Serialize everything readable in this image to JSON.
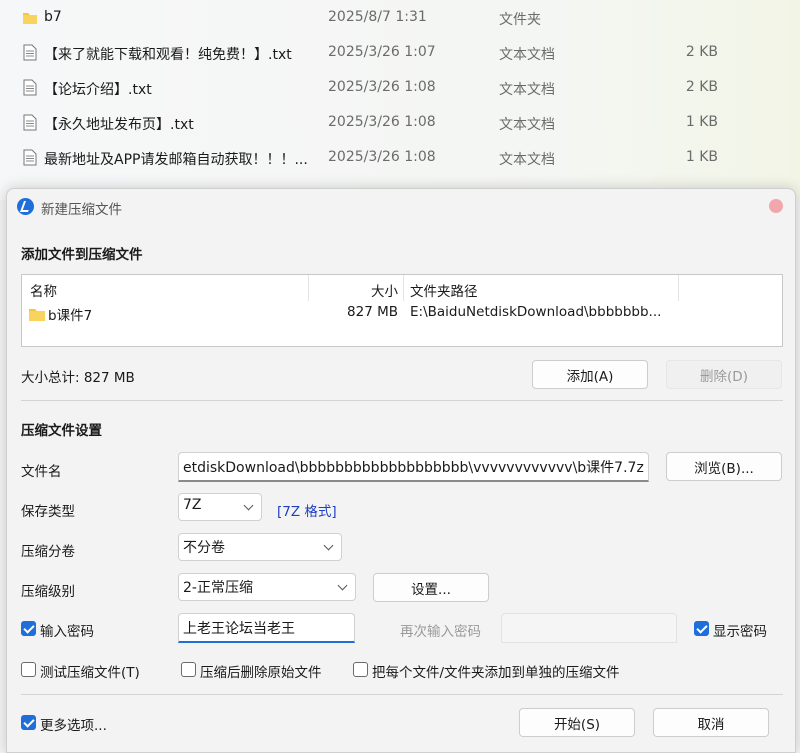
{
  "explorer": {
    "rows": [
      {
        "name": "b7",
        "date": "2025/8/7 1:31",
        "type": "文件夹",
        "size": "",
        "icon": "folder-icon"
      },
      {
        "name": "【来了就能下载和观看！纯免费！】.txt",
        "date": "2025/3/26 1:07",
        "type": "文本文档",
        "size": "2 KB",
        "icon": "text-file-icon"
      },
      {
        "name": "【论坛介绍】.txt",
        "date": "2025/3/26 1:08",
        "type": "文本文档",
        "size": "2 KB",
        "icon": "text-file-icon"
      },
      {
        "name": "【永久地址发布页】.txt",
        "date": "2025/3/26 1:08",
        "type": "文本文档",
        "size": "1 KB",
        "icon": "text-file-icon"
      },
      {
        "name": "最新地址及APP请发邮箱自动获取！！！...",
        "date": "2025/3/26 1:08",
        "type": "文本文档",
        "size": "1 KB",
        "icon": "text-file-icon"
      }
    ]
  },
  "dialog": {
    "title": "新建压缩文件",
    "add_section_title": "添加文件到压缩文件",
    "list": {
      "headers": {
        "name": "名称",
        "size": "大小",
        "path": "文件夹路径"
      },
      "rows": [
        {
          "name": "b课件7",
          "size": "827 MB",
          "path": "E:\\BaiduNetdiskDownload\\bbbbbbb..."
        }
      ]
    },
    "total_size": "大小总计: 827 MB",
    "add_button": "添加(A)",
    "delete_button": "删除(D)",
    "settings_section_title": "压缩文件设置",
    "filename_label": "文件名",
    "filename_value": "etdiskDownload\\bbbbbbbbbbbbbbbbbbb\\vvvvvvvvvvvv\\b课件7.7z",
    "browse_button": "浏览(B)...",
    "save_type_label": "保存类型",
    "save_type_value": "7Z",
    "format_link": "[7Z 格式]",
    "split_label": "压缩分卷",
    "split_value": "不分卷",
    "level_label": "压缩级别",
    "level_value": "2-正常压缩",
    "settings_button": "设置...",
    "password_label": "输入密码",
    "password_value": "上老王论坛当老王",
    "reenter_label": "再次输入密码",
    "show_password_label": "显示密码",
    "test_label": "测试压缩文件(T)",
    "delete_original_label": "压缩后删除原始文件",
    "separate_label": "把每个文件/文件夹添加到单独的压缩文件",
    "more_options_label": "更多选项...",
    "start_button": "开始(S)",
    "cancel_button": "取消"
  },
  "colors": {
    "accent": "#1e6fd9",
    "folder": "#f5c542",
    "link": "#1e3fc2"
  }
}
